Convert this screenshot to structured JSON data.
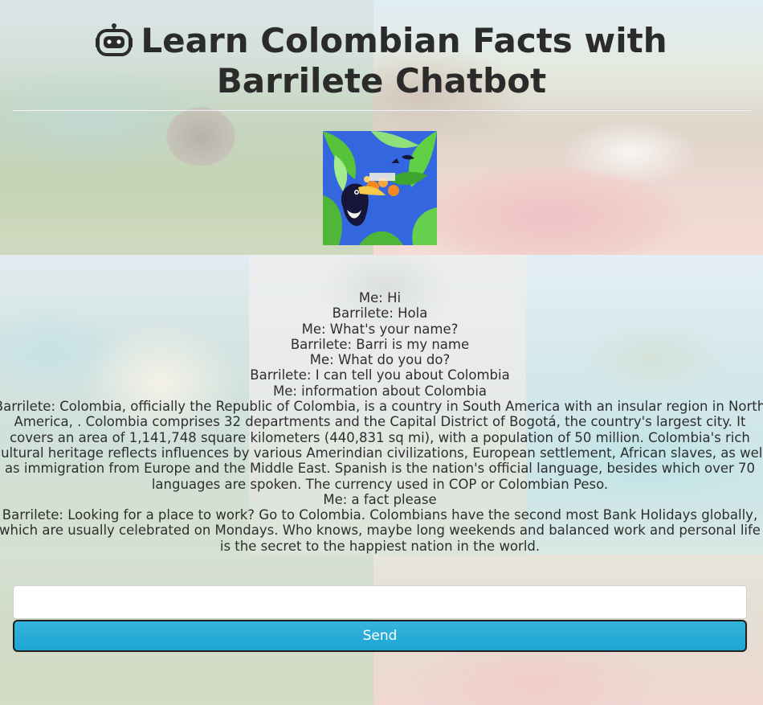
{
  "header": {
    "title": "Learn Colombian Facts with Barrilete Chatbot",
    "icon": "robot-icon"
  },
  "avatar": {
    "icon": "toucan-jungle-illustration",
    "colors": [
      "#2c5fd8",
      "#57c23b",
      "#f08a24",
      "#1a1a3a"
    ]
  },
  "chat": {
    "messages": [
      "Me: Hi",
      "Barrilete: Hola",
      "Me: What's your name?",
      "Barrilete: Barri is my name",
      "Me: What do you do?",
      "Barrilete: I can tell you about Colombia",
      "Me: information about Colombia",
      "Barrilete: Colombia, officially the Republic of Colombia, is a country in South America with an insular region in North America, . Colombia comprises 32 departments and the Capital District of Bogotá, the country's largest city. It covers an area of 1,141,748 square kilometers (440,831 sq mi), with a population of 50 million. Colombia's rich cultural heritage reflects influences by various Amerindian civilizations, European settlement, African slaves, as well as immigration from Europe and the Middle East. Spanish is the nation's official language, besides which over 70 languages are spoken. The currency used in COP or Colombian Peso.",
      "Me: a fact please",
      "Barrilete: Looking for a place to work? Go to Colombia. Colombians have the second most Bank Holidays globally, which are usually celebrated on Mondays. Who knows, maybe long weekends and balanced work and personal life is the secret to the happiest nation in the world."
    ]
  },
  "input": {
    "value": "",
    "placeholder": ""
  },
  "send": {
    "label": "Send",
    "color": "#29acd8"
  }
}
